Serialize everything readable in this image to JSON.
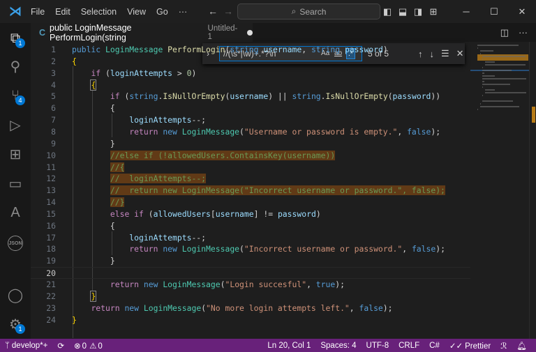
{
  "menu": {
    "items": [
      "File",
      "Edit",
      "Selection",
      "View",
      "Go",
      "···"
    ]
  },
  "titlebar": {
    "search_placeholder": "Search"
  },
  "activity": [
    {
      "icon": "explorer-icon",
      "badge": "1"
    },
    {
      "icon": "search-icon"
    },
    {
      "icon": "source-control-icon",
      "badge": "4"
    },
    {
      "icon": "run-debug-icon"
    },
    {
      "icon": "extensions-icon"
    },
    {
      "icon": "terminal-icon"
    },
    {
      "icon": "azure-icon"
    },
    {
      "icon": "json-icon",
      "label": "JSON"
    },
    {
      "icon": "account-icon"
    },
    {
      "icon": "settings-gear-icon",
      "badge": "1"
    }
  ],
  "tab": {
    "title": "public LoginMessage PerformLogin(string",
    "description": "Untitled-1"
  },
  "find": {
    "query": "//(\\s*|\\w)+.*?\\n",
    "match_case": "Aa",
    "whole_word": "ab",
    "regex": ".*",
    "count": "5 of 5"
  },
  "editor": {
    "current_line": 20,
    "highlight_lines": [
      10,
      11,
      12,
      13,
      14
    ],
    "lines": [
      [
        [
          "k",
          "public "
        ],
        [
          "t",
          "LoginMessage "
        ],
        [
          "f",
          "PerformLogin"
        ],
        [
          "p",
          "("
        ],
        [
          "k",
          "string "
        ],
        [
          "v",
          "username"
        ],
        [
          "p",
          ", "
        ],
        [
          "k",
          "string "
        ],
        [
          "v",
          "password"
        ],
        [
          "p",
          ")"
        ]
      ],
      [
        [
          "b",
          "{"
        ]
      ],
      [
        [
          "p",
          "    "
        ],
        [
          "c",
          "if "
        ],
        [
          "p",
          "("
        ],
        [
          "v",
          "loginAttempts"
        ],
        [
          "p",
          " > "
        ],
        [
          "n",
          "0"
        ],
        [
          "p",
          ")"
        ]
      ],
      [
        [
          "p",
          "    "
        ],
        [
          "b",
          "{"
        ]
      ],
      [
        [
          "p",
          "        "
        ],
        [
          "c",
          "if "
        ],
        [
          "p",
          "("
        ],
        [
          "k",
          "string"
        ],
        [
          "p",
          "."
        ],
        [
          "f",
          "IsNullOrEmpty"
        ],
        [
          "p",
          "("
        ],
        [
          "v",
          "username"
        ],
        [
          "p",
          ") || "
        ],
        [
          "k",
          "string"
        ],
        [
          "p",
          "."
        ],
        [
          "f",
          "IsNullOrEmpty"
        ],
        [
          "p",
          "("
        ],
        [
          "v",
          "password"
        ],
        [
          "p",
          "))"
        ]
      ],
      [
        [
          "p",
          "        {"
        ]
      ],
      [
        [
          "p",
          "            "
        ],
        [
          "v",
          "loginAttempts"
        ],
        [
          "p",
          "--;"
        ]
      ],
      [
        [
          "p",
          "            "
        ],
        [
          "c",
          "return "
        ],
        [
          "k",
          "new "
        ],
        [
          "t",
          "LoginMessage"
        ],
        [
          "p",
          "("
        ],
        [
          "s",
          "\"Username or password is empty.\""
        ],
        [
          "p",
          ", "
        ],
        [
          "k",
          "false"
        ],
        [
          "p",
          ");"
        ]
      ],
      [
        [
          "p",
          "        }"
        ]
      ],
      [
        [
          "p",
          "        "
        ],
        [
          "m",
          "//else if (!allowedUsers.ContainsKey(username))"
        ]
      ],
      [
        [
          "p",
          "        "
        ],
        [
          "m",
          "//{"
        ]
      ],
      [
        [
          "p",
          "        "
        ],
        [
          "m",
          "//  loginAttempts--;"
        ]
      ],
      [
        [
          "p",
          "        "
        ],
        [
          "m",
          "//  return new LoginMessage(\"Incorrect username or password.\", false);"
        ]
      ],
      [
        [
          "p",
          "        "
        ],
        [
          "m",
          "//}"
        ]
      ],
      [
        [
          "p",
          "        "
        ],
        [
          "c",
          "else if "
        ],
        [
          "p",
          "("
        ],
        [
          "v",
          "allowedUsers"
        ],
        [
          "p",
          "["
        ],
        [
          "v",
          "username"
        ],
        [
          "p",
          "] != "
        ],
        [
          "v",
          "password"
        ],
        [
          "p",
          ")"
        ]
      ],
      [
        [
          "p",
          "        {"
        ]
      ],
      [
        [
          "p",
          "            "
        ],
        [
          "v",
          "loginAttempts"
        ],
        [
          "p",
          "--;"
        ]
      ],
      [
        [
          "p",
          "            "
        ],
        [
          "c",
          "return "
        ],
        [
          "k",
          "new "
        ],
        [
          "t",
          "LoginMessage"
        ],
        [
          "p",
          "("
        ],
        [
          "s",
          "\"Incorrect username or password.\""
        ],
        [
          "p",
          ", "
        ],
        [
          "k",
          "false"
        ],
        [
          "p",
          ");"
        ]
      ],
      [
        [
          "p",
          "        }"
        ]
      ],
      [],
      [
        [
          "p",
          "        "
        ],
        [
          "c",
          "return "
        ],
        [
          "k",
          "new "
        ],
        [
          "t",
          "LoginMessage"
        ],
        [
          "p",
          "("
        ],
        [
          "s",
          "\"Login succesful\""
        ],
        [
          "p",
          ", "
        ],
        [
          "k",
          "true"
        ],
        [
          "p",
          ");"
        ]
      ],
      [
        [
          "p",
          "    "
        ],
        [
          "b",
          "}"
        ]
      ],
      [
        [
          "p",
          "    "
        ],
        [
          "c",
          "return "
        ],
        [
          "k",
          "new "
        ],
        [
          "t",
          "LoginMessage"
        ],
        [
          "p",
          "("
        ],
        [
          "s",
          "\"No more login attempts left.\""
        ],
        [
          "p",
          ", "
        ],
        [
          "k",
          "false"
        ],
        [
          "p",
          ");"
        ]
      ],
      [
        [
          "b",
          "}"
        ]
      ]
    ]
  },
  "status": {
    "branch": "develop*+",
    "errors": "0",
    "warnings": "0",
    "position": "Ln 20, Col 1",
    "spaces": "Spaces: 4",
    "encoding": "UTF-8",
    "eol": "CRLF",
    "language": "C#",
    "formatter": "Prettier"
  },
  "colors": {
    "status_bar": "#68217a",
    "accent": "#0078d4",
    "find_highlight": "#613a16"
  }
}
